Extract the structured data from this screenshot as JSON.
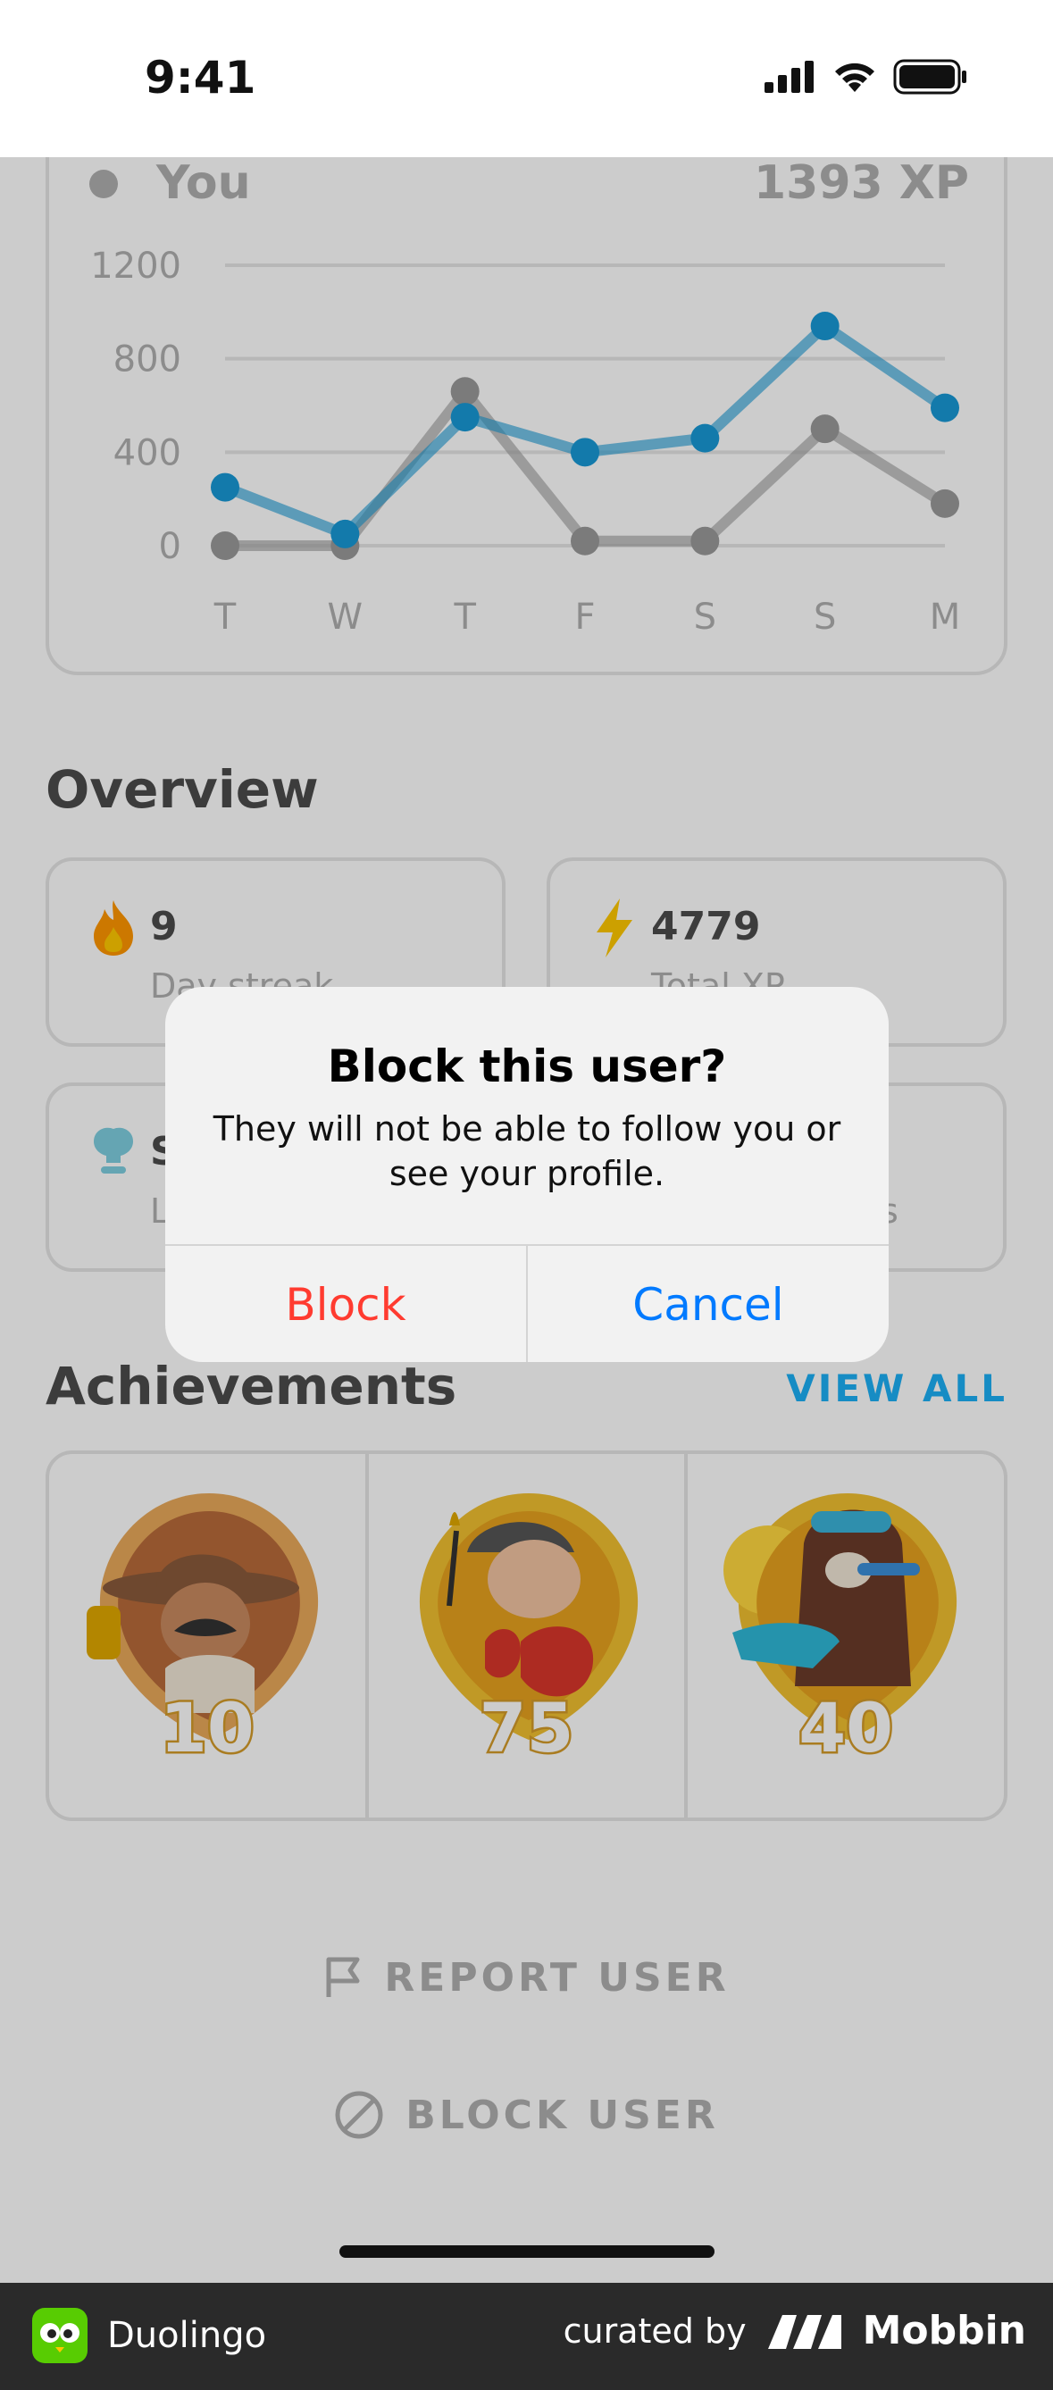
{
  "status_bar": {
    "time": "9:41"
  },
  "chart": {
    "legend_you_label": "You",
    "legend_you_value": "1393 XP"
  },
  "chart_data": {
    "type": "line",
    "categories": [
      "T",
      "W",
      "T",
      "F",
      "S",
      "S",
      "M"
    ],
    "yticks": [
      "1200",
      "800",
      "400",
      "0"
    ],
    "ylim": [
      0,
      1200
    ],
    "series": [
      {
        "name": "You",
        "color": "#1899d6",
        "values": [
          250,
          50,
          550,
          400,
          460,
          940,
          590
        ]
      },
      {
        "color": "#9a9a9a",
        "values": [
          0,
          0,
          660,
          20,
          20,
          500,
          180
        ]
      }
    ]
  },
  "overview": {
    "title": "Overview",
    "cards": [
      {
        "value": "9",
        "label": "Day streak",
        "icon": "fire-icon"
      },
      {
        "value": "4779",
        "label": "Total XP",
        "icon": "lightning-icon"
      },
      {
        "value": "S",
        "label": "L",
        "icon": "league-icon"
      },
      {
        "value": "",
        "label": "s",
        "icon": ""
      }
    ]
  },
  "achievements": {
    "title": "Achievements",
    "view_all": "VIEW ALL",
    "badges": [
      {
        "number": "10",
        "icon": "explorer-badge-icon"
      },
      {
        "number": "75",
        "icon": "boxer-badge-icon"
      },
      {
        "number": "40",
        "icon": "bear-badge-icon"
      }
    ]
  },
  "footer_actions": {
    "report": "REPORT USER",
    "block": "BLOCK USER"
  },
  "alert": {
    "title": "Block this user?",
    "message": "They will not be able to follow you or see your profile.",
    "block_label": "Block",
    "cancel_label": "Cancel"
  },
  "brand_bar": {
    "app_name": "Duolingo",
    "curated_by": "curated by",
    "mobbin": "Mobbin"
  },
  "colors": {
    "accent": "#1cb0f6",
    "alert_destructive": "#ff3b30",
    "alert_default": "#007aff"
  }
}
